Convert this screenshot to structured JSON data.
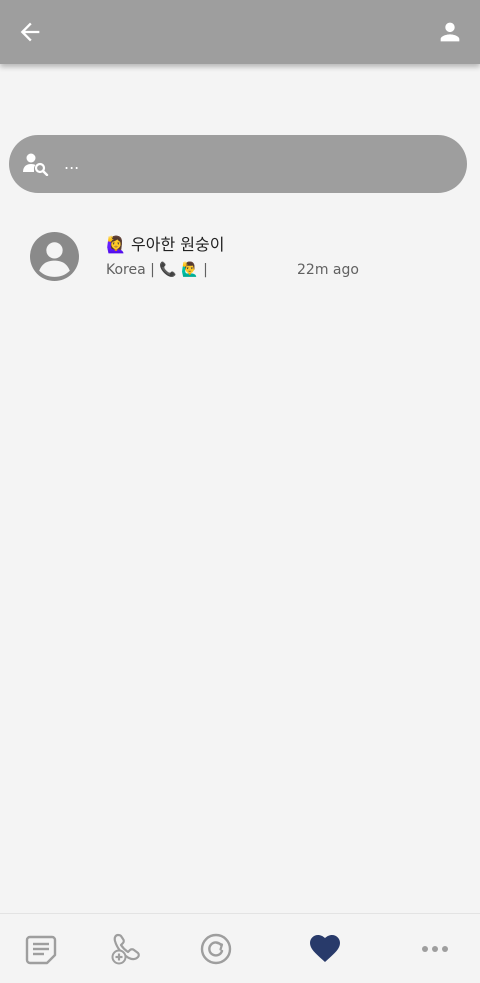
{
  "header": {
    "back_icon": "arrow-left-icon",
    "profile_icon": "person-icon",
    "background_color": "#9e9e9e"
  },
  "search": {
    "icon": "person-search-icon",
    "placeholder": "..."
  },
  "contacts": [
    {
      "avatar_icon": "account-circle-icon",
      "name": "🙋‍♀️ 우아한 원숭이",
      "meta": "Korea | 📞 🙋‍♂️ |",
      "time": "22m ago"
    }
  ],
  "bottom_nav": {
    "items": [
      {
        "id": "posts",
        "icon": "document-icon",
        "active": false
      },
      {
        "id": "add-call",
        "icon": "phone-add-icon",
        "active": false
      },
      {
        "id": "refresh",
        "icon": "refresh-icon",
        "active": false
      },
      {
        "id": "favorites",
        "icon": "heart-icon",
        "active": true
      },
      {
        "id": "more",
        "icon": "more-horizontal-icon",
        "active": false
      }
    ],
    "active_color": "#283a6a",
    "inactive_color": "#9e9e9e"
  }
}
